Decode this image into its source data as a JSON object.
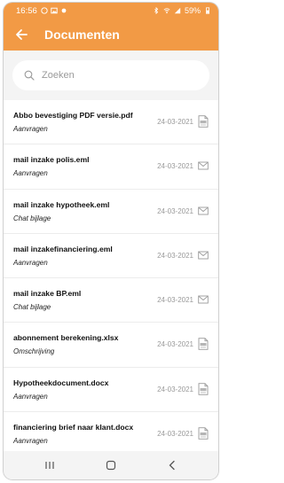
{
  "status": {
    "time": "16:56",
    "battery": "59%",
    "left_icons": [
      "whatsapp-icon",
      "image-icon",
      "notification-dot-icon"
    ],
    "right_icons": [
      "bluetooth-icon",
      "wifi-icon",
      "signal-icon",
      "battery-icon"
    ]
  },
  "appbar": {
    "title": "Documenten",
    "back_icon": "arrow-left-icon",
    "color": "#f29a45"
  },
  "search": {
    "placeholder": "Zoeken",
    "icon": "search-icon"
  },
  "documents": [
    {
      "name": "Abbo bevestiging PDF versie.pdf",
      "category": "Aanvragen",
      "date": "24-03-2021",
      "icon": "document-icon"
    },
    {
      "name": "mail inzake polis.eml",
      "category": "Aanvragen",
      "date": "24-03-2021",
      "icon": "mail-icon"
    },
    {
      "name": "mail inzake hypotheek.eml",
      "category": "Chat bijlage",
      "date": "24-03-2021",
      "icon": "mail-icon"
    },
    {
      "name": "mail inzakefinanciering.eml",
      "category": "Aanvragen",
      "date": "24-03-2021",
      "icon": "mail-icon"
    },
    {
      "name": "mail inzake BP.eml",
      "category": "Chat bijlage",
      "date": "24-03-2021",
      "icon": "mail-icon"
    },
    {
      "name": "abonnement berekening.xlsx",
      "category": "Omschrijving",
      "date": "24-03-2021",
      "icon": "document-icon"
    },
    {
      "name": "Hypotheekdocument.docx",
      "category": "Aanvragen",
      "date": "24-03-2021",
      "icon": "document-icon"
    },
    {
      "name": "financiering brief naar klant.docx",
      "category": "Aanvragen",
      "date": "24-03-2021",
      "icon": "document-icon"
    }
  ],
  "navbar": {
    "buttons": [
      "recent-apps-icon",
      "home-icon",
      "back-icon"
    ]
  }
}
